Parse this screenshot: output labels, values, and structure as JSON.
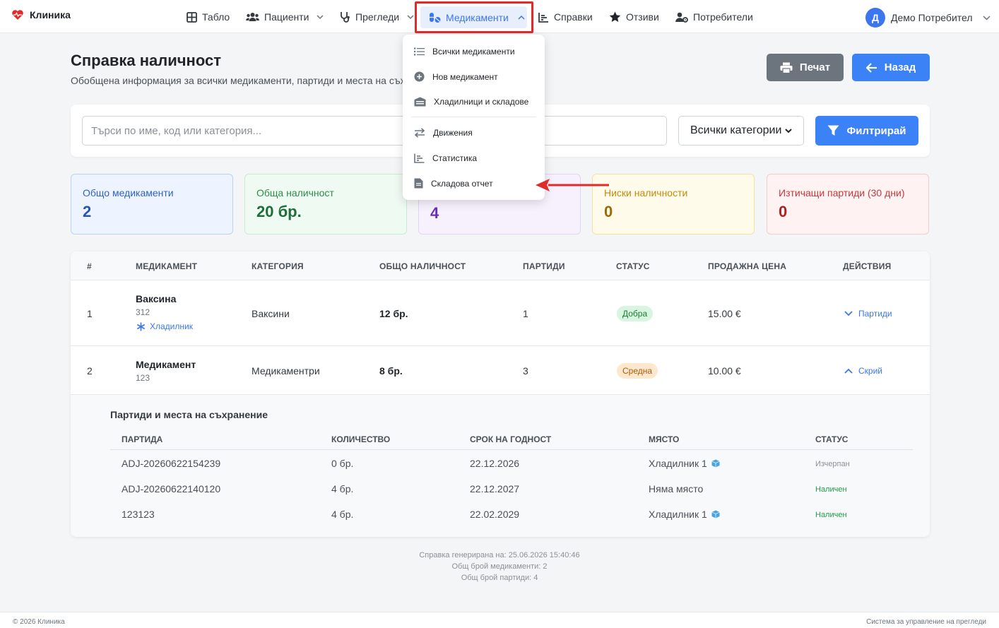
{
  "brand": {
    "name": "Клиника",
    "accent": "#e12a2a"
  },
  "nav": {
    "dashboard": "Табло",
    "patients": "Пациенти",
    "exams": "Прегледи",
    "medicines": "Медикаменти",
    "reports": "Справки",
    "reviews": "Отзиви",
    "users": "Потребители"
  },
  "user": {
    "initial": "Д",
    "name": "Демо Потребител"
  },
  "dropdown": {
    "all": "Всички медикаменти",
    "new": "Нов медикамент",
    "fridges": "Хладилници и складове",
    "movements": "Движения",
    "stats": "Статистика",
    "warehouse": "Складова отчет"
  },
  "page": {
    "title": "Справка наличност",
    "subtitle": "Обобщена информация за всички медикаменти, партиди и места на съхранение"
  },
  "buttons": {
    "print": "Печат",
    "back": "Назад",
    "filter": "Филтрирай"
  },
  "filter": {
    "search_placeholder": "Търси по име, код или категория...",
    "category": "Всички категории"
  },
  "stats": [
    {
      "label": "Общо медикаменти",
      "value": "2"
    },
    {
      "label": "Обща наличност",
      "value": "20 бр."
    },
    {
      "label": "",
      "value": "4"
    },
    {
      "label": "Ниски наличности",
      "value": "0"
    },
    {
      "label": "Изтичащи партиди (30 дни)",
      "value": "0"
    }
  ],
  "table": {
    "headers": [
      "#",
      "МЕДИКАМЕНТ",
      "КАТЕГОРИЯ",
      "ОБЩО НАЛИЧНОСТ",
      "ПАРТИДИ",
      "СТАТУС",
      "ПРОДАЖНА ЦЕНА",
      "ДЕЙСТВИЯ"
    ],
    "rows": [
      {
        "num": "1",
        "name": "Ваксина",
        "code": "312",
        "storage": "Хладилник",
        "category": "Ваксини",
        "qty": "12 бр.",
        "batches": "1",
        "status": "Добра",
        "price": "15.00 €",
        "action": "Партиди"
      },
      {
        "num": "2",
        "name": "Медикамент",
        "code": "123",
        "category": "Медикаментри",
        "qty": "8 бр.",
        "batches": "3",
        "status": "Средна",
        "price": "10.00 €",
        "action": "Скрий"
      }
    ]
  },
  "batches": {
    "title": "Партиди и места на съхранение",
    "headers": [
      "ПАРТИДА",
      "КОЛИЧЕСТВО",
      "СРОК НА ГОДНОСТ",
      "МЯСТО",
      "СТАТУС"
    ],
    "rows": [
      {
        "batch": "ADJ-20260622154239",
        "qty": "0 бр.",
        "expiry": "22.12.2026",
        "place": "Хладилник 1",
        "status": "Изчерпан"
      },
      {
        "batch": "ADJ-20260622140120",
        "qty": "4 бр.",
        "expiry": "22.12.2027",
        "place": "Няма място",
        "status": "Наличен"
      },
      {
        "batch": "123123",
        "qty": "4 бр.",
        "expiry": "22.02.2029",
        "place": "Хладилник 1",
        "status": "Наличен"
      }
    ]
  },
  "generated": {
    "line1": "Справка генерирана на: 25.06.2026 15:40:46",
    "line2": "Общ брой медикаменти: 2",
    "line3": "Общ брой партиди: 4"
  },
  "footer": {
    "left": "© 2026 Клиника",
    "right": "Система за управление на прегледи"
  },
  "colors": {
    "primary": "#3b82f6",
    "highlight": "#e12a2a",
    "success": "#1e7a3a",
    "warning": "#a85d0a"
  }
}
